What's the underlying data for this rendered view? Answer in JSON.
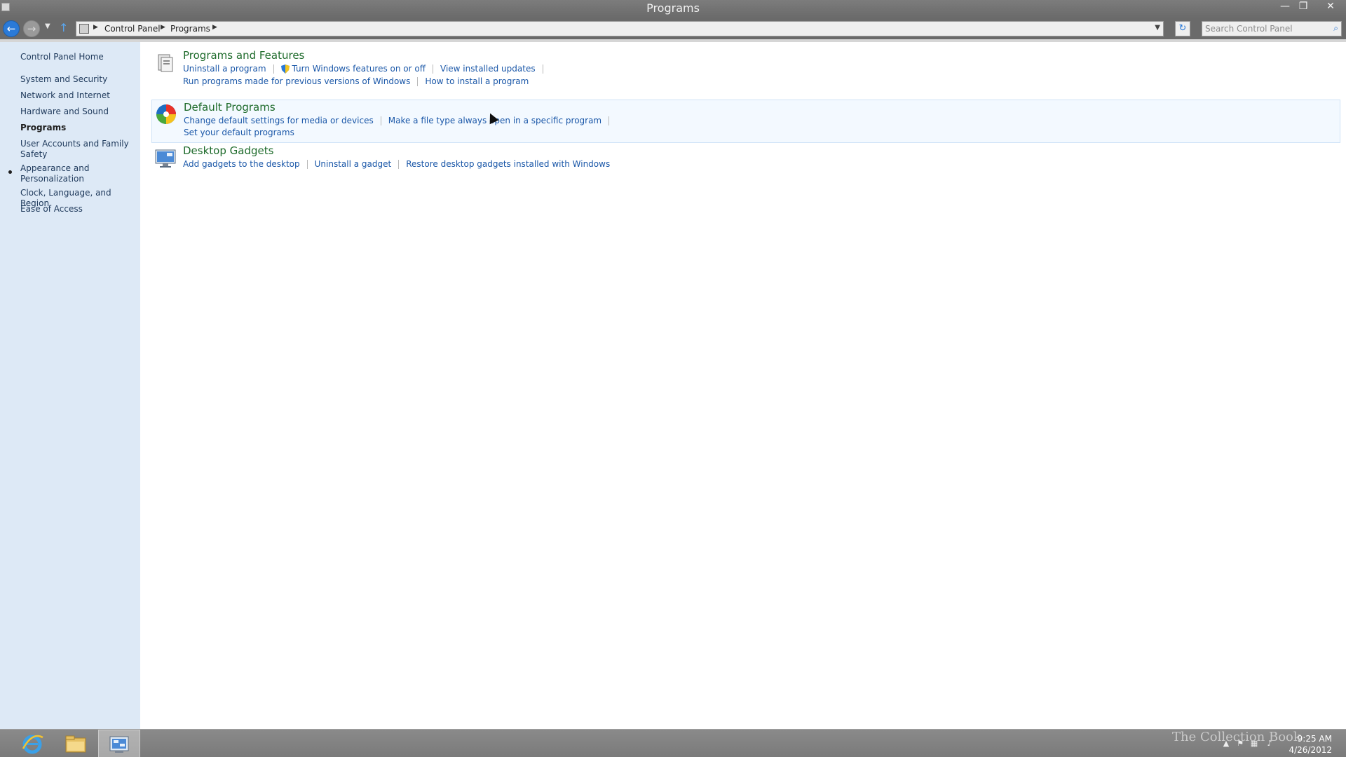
{
  "window": {
    "title": "Programs",
    "minimize_glyph": "—",
    "maximize_glyph": "❐",
    "close_glyph": "✕"
  },
  "nav": {
    "breadcrumbs": [
      "Control Panel",
      "Programs"
    ],
    "search_placeholder": "Search Control Panel"
  },
  "sidebar": {
    "home": "Control Panel Home",
    "items": [
      {
        "label": "System and Security",
        "active": false
      },
      {
        "label": "Network and Internet",
        "active": false
      },
      {
        "label": "Hardware and Sound",
        "active": false
      },
      {
        "label": "Programs",
        "active": true
      },
      {
        "label": "User Accounts and Family Safety",
        "active": false
      },
      {
        "label": "Appearance and Personalization",
        "active": false
      },
      {
        "label": "Clock, Language, and Region",
        "active": false
      },
      {
        "label": "Ease of Access",
        "active": false
      }
    ]
  },
  "categories": [
    {
      "title": "Programs and Features",
      "icon": "programs-features-icon",
      "links_row1": [
        "Uninstall a program",
        "Turn Windows features on or off",
        "View installed updates"
      ],
      "links_row2": [
        "Run programs made for previous versions of Windows",
        "How to install a program"
      ]
    },
    {
      "title": "Default Programs",
      "icon": "default-programs-icon",
      "links_row1": [
        "Change default settings for media or devices",
        "Make a file type always open in a specific program"
      ],
      "links_row2": [
        "Set your default programs"
      ]
    },
    {
      "title": "Desktop Gadgets",
      "icon": "desktop-gadgets-icon",
      "links_row1": [
        "Add gadgets to the desktop",
        "Uninstall a gadget",
        "Restore desktop gadgets installed with Windows"
      ]
    }
  ],
  "taskbar": {
    "time": "9:25 AM",
    "date": "4/26/2012",
    "watermark": "The Collection Book"
  },
  "colors": {
    "sidebar_bg": "#dde9f6",
    "link": "#1a57a8",
    "category_title": "#1e6b2b",
    "chrome": "#6d6d6d"
  }
}
